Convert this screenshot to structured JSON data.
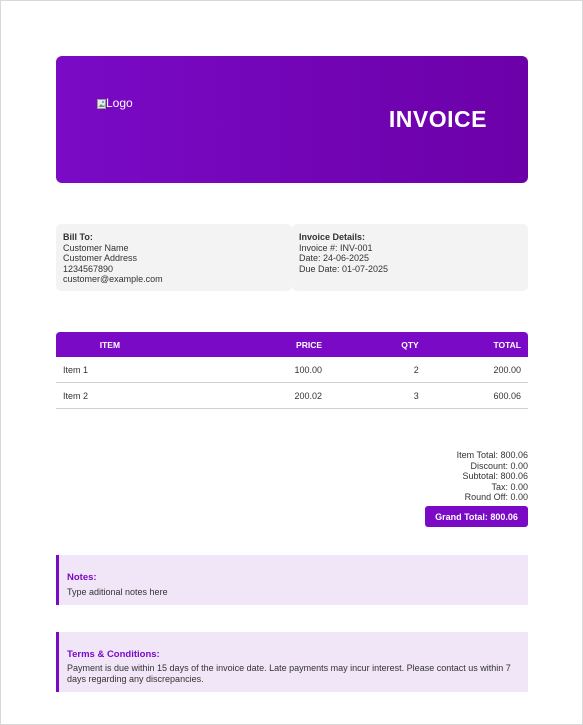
{
  "header": {
    "logo_alt": "Logo",
    "title": "INVOICE"
  },
  "bill_to": {
    "label": "Bill To:",
    "name": "Customer Name",
    "address": "Customer Address",
    "phone": "1234567890",
    "email": "customer@example.com"
  },
  "invoice_details": {
    "label": "Invoice Details:",
    "number": "Invoice #: INV-001",
    "date": "Date: 24-06-2025",
    "due_date": "Due Date: 01-07-2025"
  },
  "table": {
    "headers": [
      "ITEM",
      "PRICE",
      "QTY",
      "TOTAL"
    ],
    "rows": [
      [
        "Item 1",
        "100.00",
        "2",
        "200.00"
      ],
      [
        "Item 2",
        "200.02",
        "3",
        "600.06"
      ]
    ]
  },
  "totals": {
    "item_total": "Item Total: 800.06",
    "discount": "Discount: 0.00",
    "subtotal": "Subtotal: 800.06",
    "tax": "Tax: 0.00",
    "round_off": "Round Off: 0.00",
    "grand_total": "Grand Total: 800.06"
  },
  "notes": {
    "title": "Notes:",
    "text": "Type aditional notes here"
  },
  "terms": {
    "title": "Terms & Conditions:",
    "text": "Payment is due within 15 days of the invoice date. Late payments may incur interest. Please contact us within 7 days regarding any discrepancies."
  },
  "colors": {
    "accent": "#7a0ac6",
    "note_background": "#f1e6f7",
    "info_background": "#f3f3f3"
  }
}
